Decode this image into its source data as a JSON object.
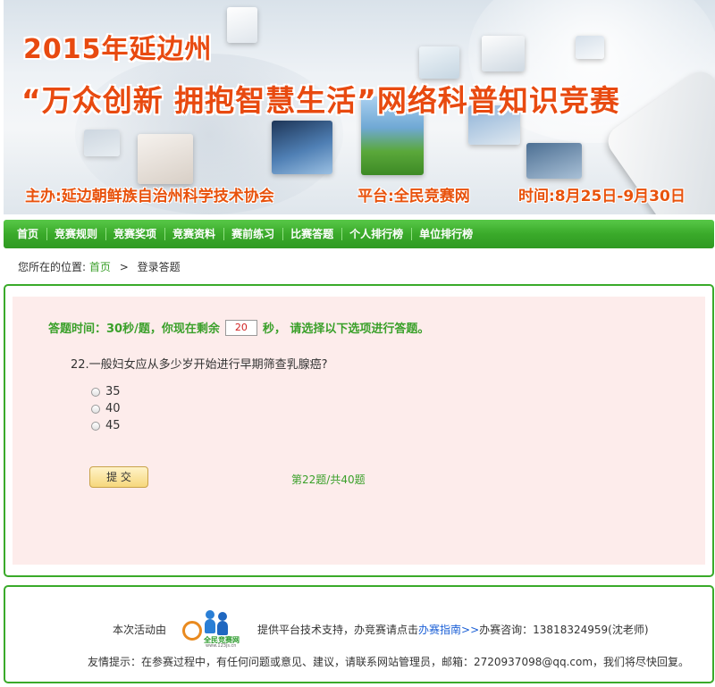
{
  "banner": {
    "title_line1": "2015年延边州",
    "title_line2": "“万众创新 拥抱智慧生活”网络科普知识竞赛",
    "organizer": "主办:延边朝鲜族自治州科学技术协会",
    "platform": "平台:全民竞赛网",
    "time": "时间:8月25日-9月30日"
  },
  "nav": {
    "items": [
      "首页",
      "竞赛规则",
      "竞赛奖项",
      "竞赛资料",
      "赛前练习",
      "比赛答题",
      "个人排行榜",
      "单位排行榜"
    ]
  },
  "breadcrumb": {
    "prefix": "您所在的位置:",
    "home": "首页",
    "separator": ">",
    "current": "登录答题"
  },
  "quiz": {
    "timer_prefix": "答题时间：30秒/题，你现在剩余",
    "timer_value": "20",
    "timer_suffix": "秒， 请选择以下选项进行答题。",
    "question": "22.一般妇女应从多少岁开始进行早期筛查乳腺癌?",
    "options": [
      "35",
      "40",
      "45"
    ],
    "submit_label": "提 交",
    "progress": "第22题/共40题"
  },
  "footer": {
    "line1_prefix": "本次活动由",
    "logo_brand": "全民竞赛网",
    "logo_url": "www.123js.cn",
    "line1_middle": "提供平台技术支持，办竞赛请点击",
    "guide_link": "办赛指南>>",
    "line1_suffix": "办赛咨询：13818324959(沈老师)",
    "line2": "友情提示：在参赛过程中，有任何问题或意见、建议，请联系网站管理员，邮箱：2720937098@qq.com，我们将尽快回复。"
  },
  "colors": {
    "accent_green": "#3aaa2a",
    "banner_orange": "#e84a10",
    "quiz_bg": "#fdeceb",
    "link_blue": "#1a5fd6"
  }
}
